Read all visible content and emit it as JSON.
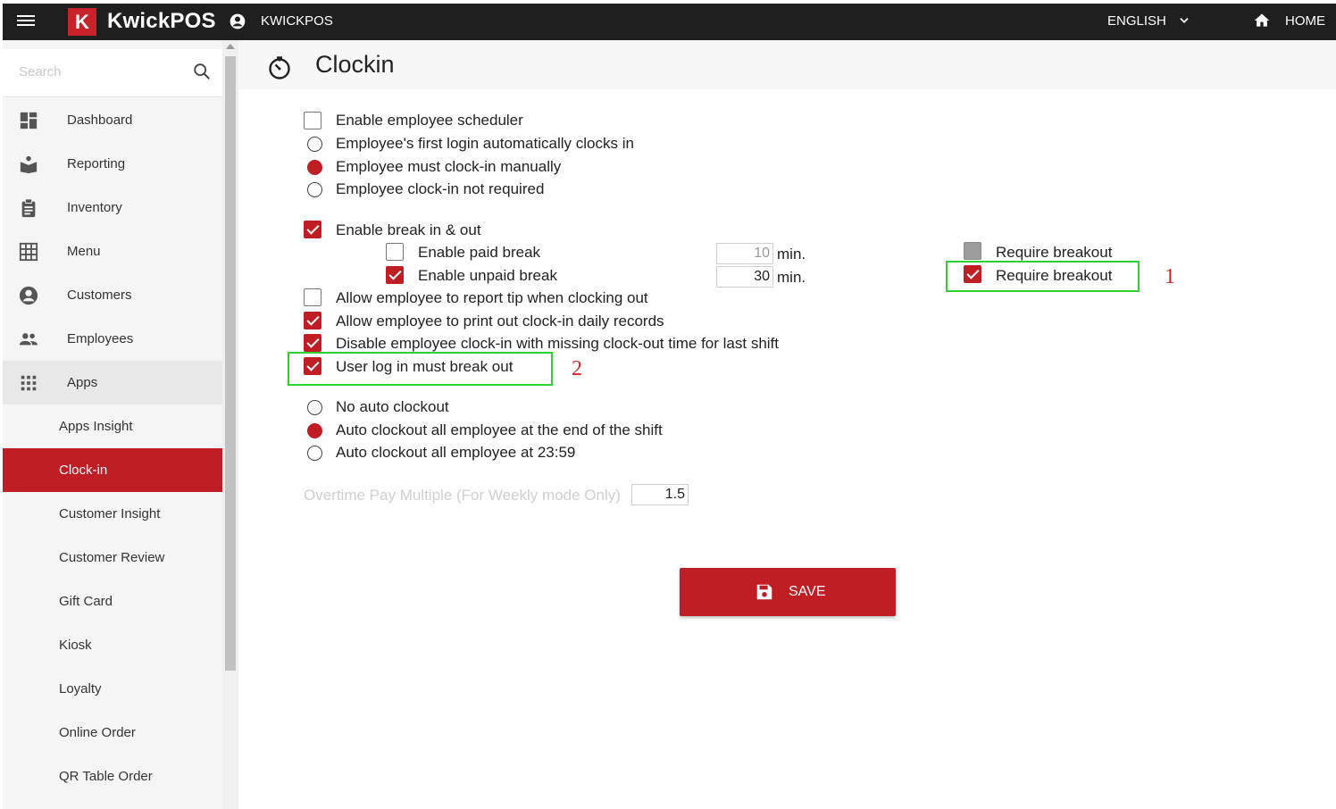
{
  "topbar": {
    "logo_letter": "K",
    "brand": "KwickPOS",
    "account": "KWICKPOS",
    "language": "ENGLISH",
    "home": "HOME"
  },
  "sidebar": {
    "search_placeholder": "Search",
    "items": [
      {
        "label": "Dashboard",
        "icon": "dashboard-icon"
      },
      {
        "label": "Reporting",
        "icon": "reporting-icon"
      },
      {
        "label": "Inventory",
        "icon": "clipboard-icon"
      },
      {
        "label": "Menu",
        "icon": "grid-icon"
      },
      {
        "label": "Customers",
        "icon": "account-circle-icon"
      },
      {
        "label": "Employees",
        "icon": "people-icon"
      },
      {
        "label": "Apps",
        "icon": "apps-icon"
      }
    ],
    "sub_items": [
      {
        "label": "Apps Insight",
        "selected": false
      },
      {
        "label": "Clock-in",
        "selected": true
      },
      {
        "label": "Customer Insight",
        "selected": false
      },
      {
        "label": "Customer Review",
        "selected": false
      },
      {
        "label": "Gift Card",
        "selected": false
      },
      {
        "label": "Kiosk",
        "selected": false
      },
      {
        "label": "Loyalty",
        "selected": false
      },
      {
        "label": "Online Order",
        "selected": false
      },
      {
        "label": "QR Table Order",
        "selected": false
      }
    ]
  },
  "page": {
    "title": "Clockin"
  },
  "settings": {
    "enable_scheduler": {
      "label": "Enable employee scheduler",
      "checked": false
    },
    "clockin_modes": [
      {
        "label": "Employee's first login automatically clocks in",
        "selected": false
      },
      {
        "label": "Employee must clock-in manually",
        "selected": true
      },
      {
        "label": "Employee clock-in not required",
        "selected": false
      }
    ],
    "enable_break": {
      "label": "Enable break in & out",
      "checked": true
    },
    "paid_break": {
      "label": "Enable paid break",
      "checked": false,
      "minutes": "10",
      "unit": "min.",
      "require_label": "Require breakout",
      "require_checked": false
    },
    "unpaid_break": {
      "label": "Enable unpaid break",
      "checked": true,
      "minutes": "30",
      "unit": "min.",
      "require_label": "Require breakout",
      "require_checked": true
    },
    "report_tip": {
      "label": "Allow employee to report tip when clocking out",
      "checked": false
    },
    "print_records": {
      "label": "Allow employee to print out clock-in daily records",
      "checked": true
    },
    "disable_missing": {
      "label": "Disable employee clock-in with missing clock-out time for last shift",
      "checked": true
    },
    "must_break_out": {
      "label": "User log in must break out",
      "checked": true
    },
    "auto_clockout": [
      {
        "label": "No auto clockout",
        "selected": false
      },
      {
        "label": "Auto clockout all employee at the end of the shift",
        "selected": true
      },
      {
        "label": "Auto clockout all employee at 23:59",
        "selected": false
      }
    ],
    "overtime": {
      "label": "Overtime Pay Multiple (For Weekly mode Only)",
      "value": "1.5"
    }
  },
  "annotations": {
    "one": "1",
    "two": "2"
  },
  "save": {
    "label": "SAVE"
  },
  "colors": {
    "brand_red": "#be1e24",
    "topbar": "#1f1f1f",
    "highlight_green": "#2fd12f"
  }
}
